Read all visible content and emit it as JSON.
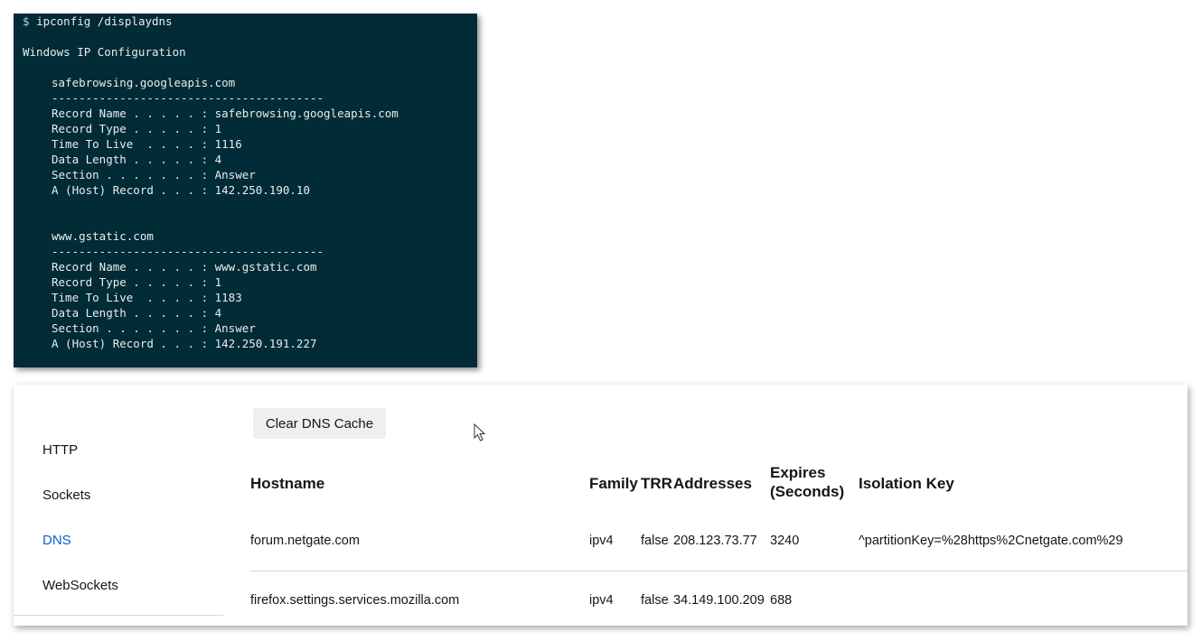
{
  "terminal": {
    "prompt": "$",
    "command": "ipconfig /displaydns",
    "heading": "Windows IP Configuration",
    "separator": "----------------------------------------",
    "entries": [
      {
        "host": "safebrowsing.googleapis.com",
        "fields": [
          {
            "label": "Record Name . . . . . :",
            "value": "safebrowsing.googleapis.com"
          },
          {
            "label": "Record Type . . . . . :",
            "value": "1"
          },
          {
            "label": "Time To Live  . . . . :",
            "value": "1116"
          },
          {
            "label": "Data Length . . . . . :",
            "value": "4"
          },
          {
            "label": "Section . . . . . . . :",
            "value": "Answer"
          },
          {
            "label": "A (Host) Record . . . :",
            "value": "142.250.190.10"
          }
        ]
      },
      {
        "host": "www.gstatic.com",
        "fields": [
          {
            "label": "Record Name . . . . . :",
            "value": "www.gstatic.com"
          },
          {
            "label": "Record Type . . . . . :",
            "value": "1"
          },
          {
            "label": "Time To Live  . . . . :",
            "value": "1183"
          },
          {
            "label": "Data Length . . . . . :",
            "value": "4"
          },
          {
            "label": "Section . . . . . . . :",
            "value": "Answer"
          },
          {
            "label": "A (Host) Record . . . :",
            "value": "142.250.191.227"
          }
        ]
      }
    ]
  },
  "sidebar": {
    "items": [
      {
        "label": "HTTP",
        "active": false
      },
      {
        "label": "Sockets",
        "active": false
      },
      {
        "label": "DNS",
        "active": true
      },
      {
        "label": "WebSockets",
        "active": false
      }
    ]
  },
  "toolbar": {
    "clear_label": "Clear DNS Cache"
  },
  "table": {
    "headers": {
      "hostname": "Hostname",
      "family": "Family",
      "trr": "TRR",
      "addresses": "Addresses",
      "expires_line1": "Expires",
      "expires_line2": "(Seconds)",
      "isolation": "Isolation Key"
    },
    "rows": [
      {
        "hostname": "forum.netgate.com",
        "family": "ipv4",
        "trr": "false",
        "addresses": "208.123.73.77",
        "expires": "3240",
        "isolation": "^partitionKey=%28https%2Cnetgate.com%29"
      },
      {
        "hostname": "firefox.settings.services.mozilla.com",
        "family": "ipv4",
        "trr": "false",
        "addresses": "34.149.100.209",
        "expires": "688",
        "isolation": ""
      }
    ]
  },
  "colors": {
    "terminal_bg": "#012b36",
    "active_link": "#0b61d6"
  }
}
